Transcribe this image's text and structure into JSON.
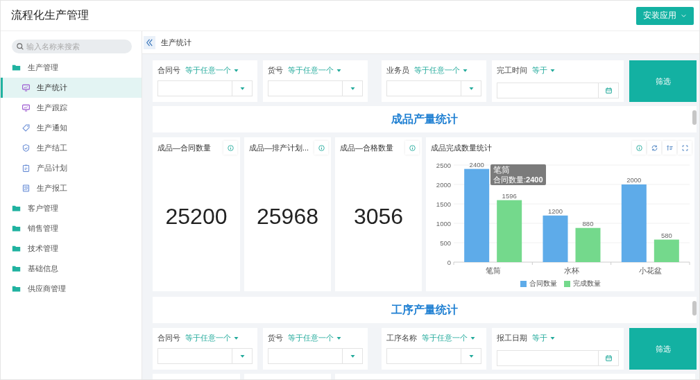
{
  "app": {
    "title": "流程化生产管理",
    "install_button": "安装应用"
  },
  "sidebar": {
    "search": {
      "placeholder": "输入名称来搜索"
    },
    "items": [
      {
        "label": "生产管理",
        "children": [
          {
            "label": "生产统计",
            "selected": true
          },
          {
            "label": "生产跟踪",
            "selected": false
          },
          {
            "label": "生产通知",
            "selected": false
          },
          {
            "label": "生产结工",
            "selected": false
          },
          {
            "label": "产品计划",
            "selected": false
          },
          {
            "label": "生产报工",
            "selected": false
          }
        ]
      },
      {
        "label": "客户管理"
      },
      {
        "label": "销售管理"
      },
      {
        "label": "技术管理"
      },
      {
        "label": "基础信息"
      },
      {
        "label": "供应商管理"
      }
    ]
  },
  "breadcrumb": "生产统计",
  "sections": [
    {
      "filters": [
        {
          "label": "合同号",
          "operator": "等于任意一个",
          "kind": "select"
        },
        {
          "label": "货号",
          "operator": "等于任意一个",
          "kind": "select"
        },
        {
          "label": "业务员",
          "operator": "等于任意一个",
          "kind": "select"
        },
        {
          "label": "完工时间",
          "operator": "等于",
          "kind": "date"
        }
      ],
      "filter_button": "筛选",
      "title": "成品产量统计",
      "cards": [
        {
          "kind": "number",
          "title": "成品—合同数量",
          "value": "25200"
        },
        {
          "kind": "number",
          "title": "成品—排产计划...",
          "value": "25968"
        },
        {
          "kind": "number",
          "title": "成品—合格数量",
          "value": "3056"
        },
        {
          "kind": "chart",
          "title": "成品完成数量统计",
          "tooltip": {
            "title": "笔筒",
            "text": "合同数量:**2400**"
          },
          "chart_data": {
            "type": "bar",
            "categories": [
              "笔筒",
              "水杯",
              "小花盆"
            ],
            "series": [
              {
                "name": "合同数量",
                "color": "#5eabe9",
                "values": [
                  2400,
                  1200,
                  2000
                ]
              },
              {
                "name": "完成数量",
                "color": "#74d98c",
                "values": [
                  1596,
                  880,
                  580
                ]
              }
            ],
            "ylim": [
              0,
              2500
            ],
            "yticks": [
              0,
              500,
              1000,
              1500,
              2000,
              2500
            ],
            "data_labels": true,
            "grid": true,
            "legend": "bottom"
          }
        }
      ]
    },
    {
      "title": "工序产量统计",
      "filters": [
        {
          "label": "合同号",
          "operator": "等于任意一个",
          "kind": "select"
        },
        {
          "label": "货号",
          "operator": "等于任意一个",
          "kind": "select"
        },
        {
          "label": "工序名称",
          "operator": "等于任意一个",
          "kind": "select"
        },
        {
          "label": "报工日期",
          "operator": "等于",
          "kind": "date"
        }
      ],
      "filter_button": "筛选"
    }
  ]
}
